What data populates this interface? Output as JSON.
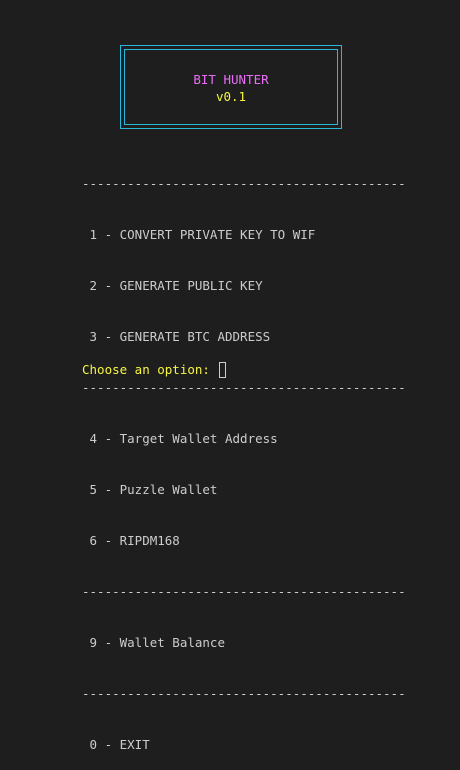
{
  "banner": {
    "title": "BIT HUNTER",
    "version": "v0.1"
  },
  "separator": "-------------------------------------------",
  "menu": {
    "group1": [
      " 1 - CONVERT PRIVATE KEY TO WIF",
      " 2 - GENERATE PUBLIC KEY",
      " 3 - GENERATE BTC ADDRESS"
    ],
    "group2": [
      " 4 - Target Wallet Address",
      " 5 - Puzzle Wallet",
      " 6 - RIPDM168"
    ],
    "group3": [
      " 9 - Wallet Balance"
    ],
    "group4": [
      " 0 - EXIT"
    ]
  },
  "prompt": {
    "text": "Choose an option: "
  },
  "colors": {
    "background": "#1e1e1e",
    "text": "#cccccc",
    "border": "#29b8db",
    "title": "#e86ff5",
    "accent": "#f5f543"
  }
}
